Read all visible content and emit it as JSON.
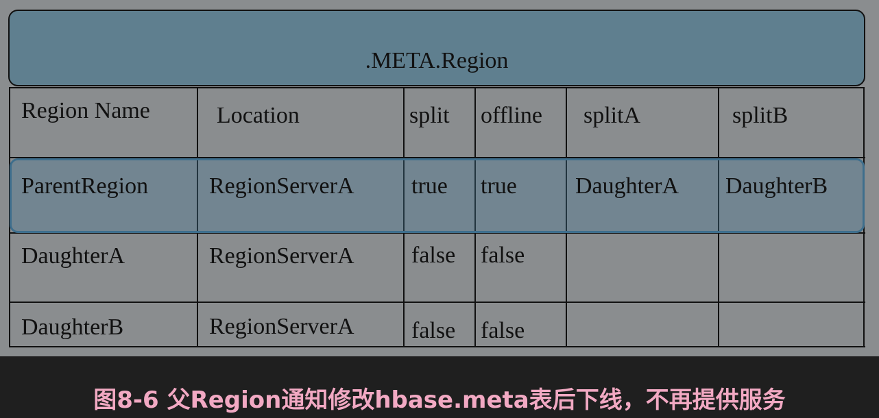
{
  "diagram": {
    "title": ".META.Region",
    "columns": [
      "Region Name",
      "Location",
      "split",
      "offline",
      "splitA",
      "splitB"
    ],
    "rows": [
      [
        "ParentRegion",
        "RegionServerA",
        "true",
        "true",
        "DaughterA",
        "DaughterB"
      ],
      [
        "DaughterA",
        "RegionServerA",
        "false",
        "false",
        "",
        ""
      ],
      [
        "DaughterB",
        "RegionServerA",
        "false",
        "false",
        "",
        ""
      ]
    ],
    "highlighted_row": 0
  },
  "caption": "图8-6 父Region通知修改hbase.meta表后下线，不再提供服务",
  "colors": {
    "panel": "#8a8d8f",
    "header": "#5f7f8f",
    "highlight_border": "#3e6e8c",
    "caption": "#f2a9c3",
    "background": "#1f1f1f"
  }
}
